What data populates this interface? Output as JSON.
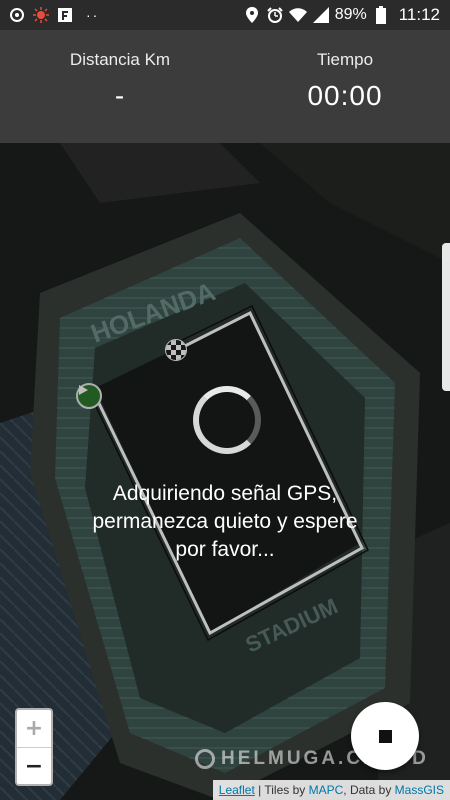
{
  "status_bar": {
    "icons_left": [
      "location-ring-icon",
      "settings-sun-icon",
      "notification-flag-icon"
    ],
    "dots": "··",
    "icons_right": [
      "location-pin-icon",
      "alarm-icon",
      "wifi-icon",
      "signal-icon"
    ],
    "battery": "89%",
    "time": "11:12"
  },
  "stats": {
    "distance_label": "Distancia Km",
    "distance_value": "-",
    "time_label": "Tiempo",
    "time_value": "00:00"
  },
  "map": {
    "start_marker": "play-start-icon",
    "finish_marker": "checkered-flag-icon"
  },
  "loading": {
    "message_line1": "Adquiriendo señal GPS,",
    "message_line2": "permanezca quieto y espere",
    "message_line3": "por favor..."
  },
  "zoom": {
    "in_label": "+",
    "out_label": "−"
  },
  "watermark": "HELMUGA.CLOUD",
  "attribution": {
    "leaflet": "Leaflet",
    "sep1": " | Tiles by ",
    "mapc": "MAPC",
    "sep2": ", Data by ",
    "massgis": "MassGIS"
  }
}
